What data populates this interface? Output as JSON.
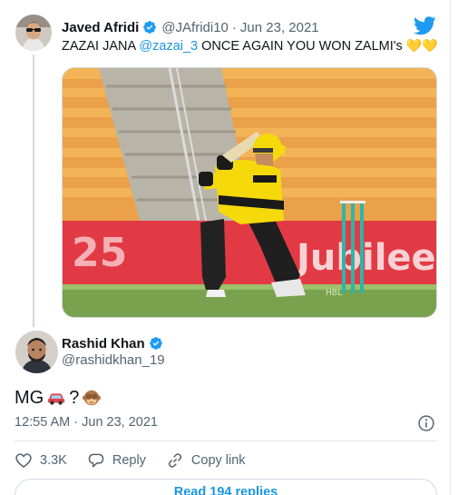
{
  "parent_tweet": {
    "author_name": "Javed Afridi",
    "handle": "@JAfridi10",
    "separator": "·",
    "date": "Jun 23, 2021",
    "text_before": "ZAZAI JANA ",
    "mention": "@zazai_3",
    "text_after": " ONCE AGAIN YOU WON ZALMI's ",
    "hearts": "💛💛",
    "media": {
      "board_left": "25",
      "board_right": "Jubilee",
      "pitch_marker": "HBL"
    }
  },
  "main_tweet": {
    "author_name": "Rashid Khan",
    "handle": "@rashidkhan_19",
    "text_before": "MG ",
    "text_after": "?",
    "timestamp": "12:55 AM · Jun 23, 2021"
  },
  "actions": {
    "likes": "3.3K",
    "reply": "Reply",
    "copy_link": "Copy link"
  },
  "read_replies": "Read 194 replies",
  "colors": {
    "twitter_blue": "#1d9bf0",
    "text_primary": "#0f1419",
    "text_secondary": "#536471",
    "border": "#cfd9de",
    "stadium_seats": "#f0a63a",
    "board_red": "#e63946",
    "kit_yellow": "#f5d90a"
  },
  "icons": [
    "verified-badge-icon",
    "twitter-bird-icon",
    "info-icon",
    "heart-icon",
    "reply-icon",
    "link-icon",
    "car-emoji",
    "monkey-emoji"
  ]
}
